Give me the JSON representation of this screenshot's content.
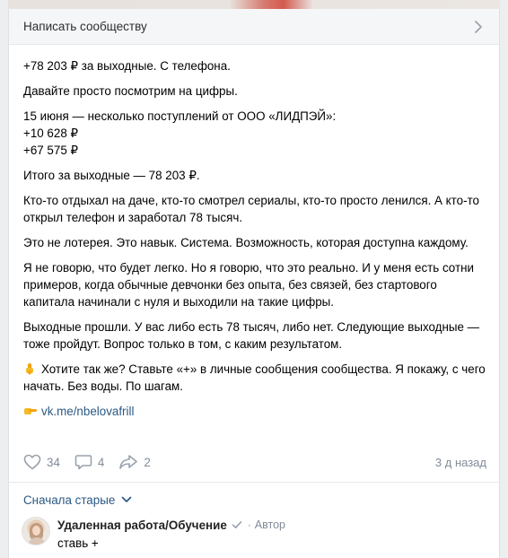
{
  "write_row": {
    "label": "Написать сообществу"
  },
  "post": {
    "paragraphs": [
      "+78 203 ₽ за выходные. С телефона.",
      "Давайте просто посмотрим на цифры.",
      "15 июня — несколько поступлений от ООО «ЛИДПЭЙ»:",
      "+10 628 ₽",
      "+67 575 ₽",
      "Итого за выходные — 78 203 ₽.",
      "Кто-то отдыхал на даче, кто-то смотрел сериалы, кто-то просто ленился. А кто-то открыл телефон и заработал 78 тысяч.",
      "Это не лотерея. Это навык. Система. Возможность, которая доступна каждому.",
      "Я не говорю, что будет легко. Но я говорю, что это реально. И у меня есть сотни примеров, когда обычные девчонки без опыта, без связей, без стартового капитала начинали с нуля и выходили на такие цифры.",
      "Выходные прошли. У вас либо есть 78 тысяч, либо нет. Следующие выходные — тоже пройдут. Вопрос только в том, с каким результатом.",
      "Хотите так же? Ставьте «+» в личные сообщения сообщества. Я покажу, с чего начать. Без воды. По шагам."
    ],
    "link": "vk.me/nbelovafrill",
    "cta_icon": "pointing-down-hand-icon",
    "link_icon": "pointing-right-hand-icon"
  },
  "actions": {
    "likes": "34",
    "comments": "4",
    "shares": "2",
    "time": "3 д назад"
  },
  "sort": {
    "label": "Сначала старые"
  },
  "comment": {
    "author": "Удаленная работа/Обучение",
    "separator": "·",
    "role": "Автор",
    "text": "ставь +"
  },
  "colors": {
    "link": "#2a5885",
    "muted": "#818c99",
    "accent": "#f0a30a"
  }
}
